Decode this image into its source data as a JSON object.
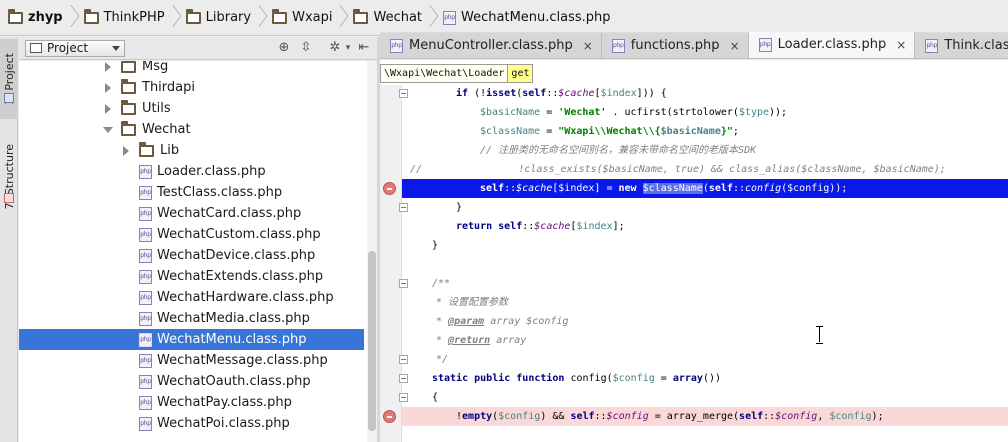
{
  "breadcrumb": [
    {
      "label": "zhyp"
    },
    {
      "label": "ThinkPHP"
    },
    {
      "label": "Library"
    },
    {
      "label": "Wxapi"
    },
    {
      "label": "Wechat"
    },
    {
      "label": "WechatMenu.class.php"
    }
  ],
  "tool_windows": {
    "project_tab": "1: Project",
    "structure_tab": "7: Structure"
  },
  "project_panel": {
    "view_label": "Project"
  },
  "tree": [
    {
      "label": "Msg",
      "type": "folder",
      "state": "collapsed",
      "depth": 1
    },
    {
      "label": "Thirdapi",
      "type": "folder",
      "state": "collapsed",
      "depth": 1
    },
    {
      "label": "Utils",
      "type": "folder",
      "state": "collapsed",
      "depth": 1
    },
    {
      "label": "Wechat",
      "type": "folder",
      "state": "expanded",
      "depth": 1
    },
    {
      "label": "Lib",
      "type": "folder",
      "state": "collapsed",
      "depth": 2
    },
    {
      "label": "Loader.class.php",
      "type": "file",
      "depth": 2
    },
    {
      "label": "TestClass.class.php",
      "type": "file",
      "depth": 2
    },
    {
      "label": "WechatCard.class.php",
      "type": "file",
      "depth": 2
    },
    {
      "label": "WechatCustom.class.php",
      "type": "file",
      "depth": 2
    },
    {
      "label": "WechatDevice.class.php",
      "type": "file",
      "depth": 2
    },
    {
      "label": "WechatExtends.class.php",
      "type": "file",
      "depth": 2
    },
    {
      "label": "WechatHardware.class.php",
      "type": "file",
      "depth": 2
    },
    {
      "label": "WechatMedia.class.php",
      "type": "file",
      "depth": 2
    },
    {
      "label": "WechatMenu.class.php",
      "type": "file",
      "depth": 2,
      "selected": true
    },
    {
      "label": "WechatMessage.class.php",
      "type": "file",
      "depth": 2
    },
    {
      "label": "WechatOauth.class.php",
      "type": "file",
      "depth": 2
    },
    {
      "label": "WechatPay.class.php",
      "type": "file",
      "depth": 2
    },
    {
      "label": "WechatPoi.class.php",
      "type": "file",
      "depth": 2
    }
  ],
  "tabs": [
    {
      "label": "MenuController.class.php",
      "close": "×"
    },
    {
      "label": "functions.php",
      "close": "×"
    },
    {
      "label": "Loader.class.php",
      "close": "×",
      "active": true
    },
    {
      "label": "Think.class.php",
      "close": "×"
    }
  ],
  "navbar": {
    "path": "\\Wxapi\\Wechat\\Loader",
    "func": "get"
  },
  "file_icon_text": "php",
  "colors": {
    "selection": "#3875d7",
    "exec_line": "#0a18e8",
    "breakpoint_line": "#fbd8d8",
    "breakpoint": "#e07b7b"
  }
}
